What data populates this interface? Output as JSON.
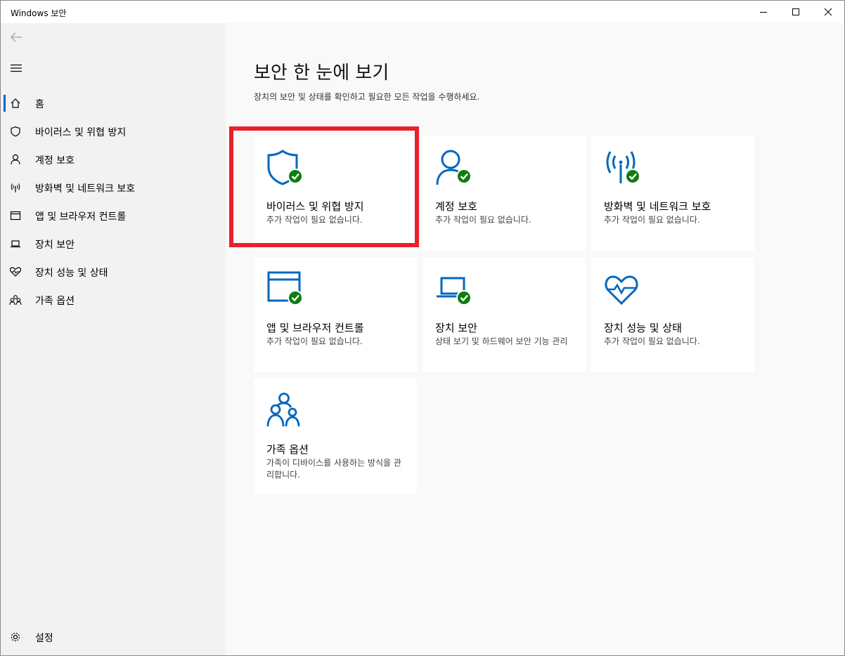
{
  "window": {
    "title": "Windows 보안"
  },
  "sidebar": {
    "items": [
      {
        "label": "홈",
        "icon": "home-icon",
        "active": true
      },
      {
        "label": "바이러스 및 위협 방지",
        "icon": "shield-icon"
      },
      {
        "label": "계정 보호",
        "icon": "person-icon"
      },
      {
        "label": "방화벽 및 네트워크 보호",
        "icon": "antenna-icon"
      },
      {
        "label": "앱 및 브라우저 컨트롤",
        "icon": "browser-window-icon"
      },
      {
        "label": "장치 보안",
        "icon": "laptop-icon"
      },
      {
        "label": "장치 성능 및 상태",
        "icon": "heart-pulse-icon"
      },
      {
        "label": "가족 옵션",
        "icon": "family-icon"
      }
    ],
    "settings_label": "설정"
  },
  "main": {
    "title": "보안 한 눈에 보기",
    "subtitle": "장치의 보안 및 상태를 확인하고 필요한 모든 작업을 수행하세요.",
    "tiles": [
      {
        "title": "바이러스 및 위협 방지",
        "desc": "추가 작업이 필요 없습니다.",
        "icon": "shield-check-icon"
      },
      {
        "title": "계정 보호",
        "desc": "추가 작업이 필요 없습니다.",
        "icon": "person-check-icon"
      },
      {
        "title": "방화벽 및 네트워크 보호",
        "desc": "추가 작업이 필요 없습니다.",
        "icon": "antenna-check-icon"
      },
      {
        "title": "앱 및 브라우저 컨트롤",
        "desc": "추가 작업이 필요 없습니다.",
        "icon": "browser-check-icon"
      },
      {
        "title": "장치 보안",
        "desc": "상태 보기 및 하드웨어 보안 기능 관리",
        "icon": "laptop-check-icon"
      },
      {
        "title": "장치 성능 및 상태",
        "desc": "추가 작업이 필요 없습니다.",
        "icon": "heart-pulse-icon"
      },
      {
        "title": "가족 옵션",
        "desc": "가족이 디바이스를 사용하는 방식을 관리합니다.",
        "icon": "family-icon"
      }
    ]
  },
  "colors": {
    "accent": "#0067c0",
    "ok_green": "#107c10",
    "highlight_red": "#e8202a"
  }
}
